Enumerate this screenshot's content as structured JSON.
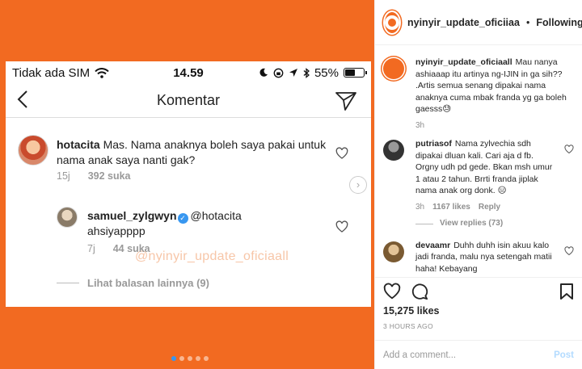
{
  "post_image": {
    "statusbar": {
      "carrier": "Tidak ada SIM",
      "time": "14.59",
      "battery": "55%",
      "battery_level": 0.55
    },
    "screen_title": "Komentar",
    "comment": {
      "username": "hotacita",
      "text": "Mas. Nama anaknya boleh saya pakai untuk nama anak saya nanti gak?",
      "time": "15j",
      "likes": "392 suka"
    },
    "reply": {
      "username": "samuel_zylgwyn",
      "mention": "@hotacita",
      "text": "ahsiyapppp",
      "time": "7j",
      "likes": "44 suka"
    },
    "more_replies": "Lihat balasan lainnya (9)",
    "watermark": "@nyinyir_update_oficiaall",
    "carousel": {
      "count": 5,
      "active": 0
    }
  },
  "side": {
    "header": {
      "username": "nyinyir_update_oficiiaa",
      "separator": "•",
      "follow_label": "Following"
    },
    "comments": [
      {
        "username": "nyinyir_update_oficiaall",
        "text": "Mau nanya ashiaaap itu artinya ng-IJIN in ga sih?? .Artis semua senang dipakai nama anaknya cuma mbak franda yg ga boleh gaesss😓",
        "time": "3h"
      },
      {
        "username": "putriasof",
        "text": "Nama zylvechia sdh dipakai dluan kali. Cari aja d fb. Orgny udh pd gede. Bkan msh umur 1 atau 2 tahun. Brrti franda jiplak nama anak org donk. 😑",
        "time": "3h",
        "likes": "1167 likes",
        "reply_label": "Reply",
        "view_replies": "View replies (73)"
      },
      {
        "username": "devaamr",
        "text": "Duhh duhh isin akuu kalo jadi franda, malu nya setengah matii haha! Kebayang"
      }
    ],
    "likes": "15,275 likes",
    "time_ago": "3 HOURS AGO",
    "add_comment_placeholder": "Add a comment...",
    "post_label": "Post"
  }
}
